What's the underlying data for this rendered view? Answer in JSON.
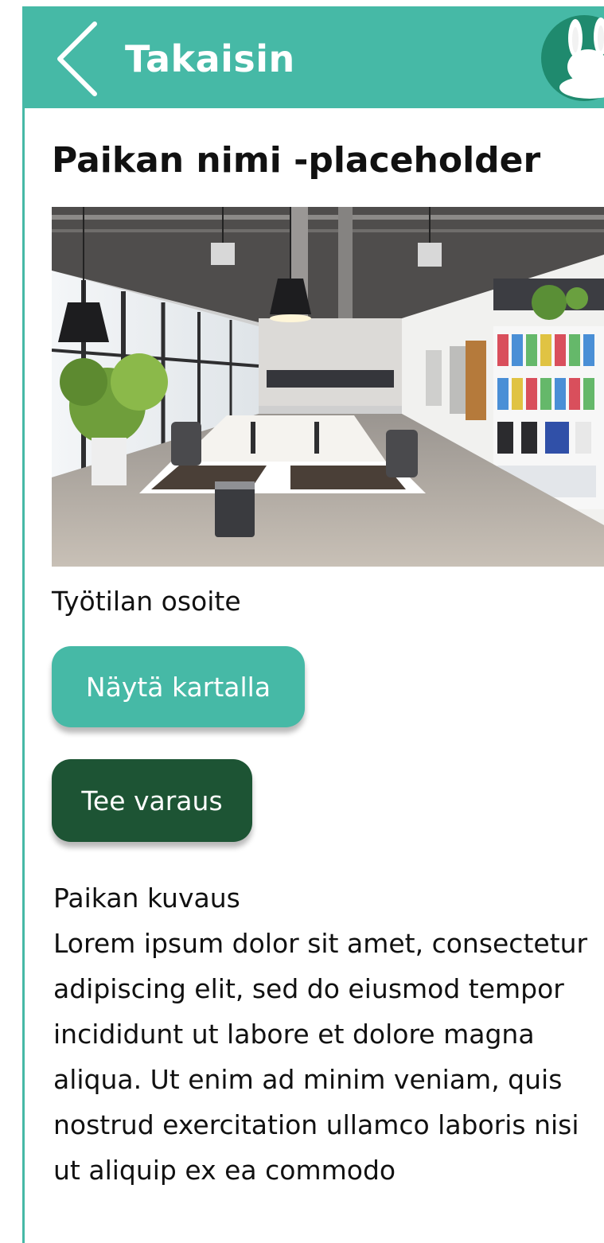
{
  "header": {
    "back_label": "Takaisin",
    "color": "#46b9a6",
    "back_icon": "chevron-left-icon",
    "avatar_icon": "bunny-avatar-icon"
  },
  "place": {
    "title": "Paikan nimi -placeholder",
    "image_icon": "office-photo",
    "address": "Työtilan osoite"
  },
  "actions": {
    "show_on_map": "Näytä kartalla",
    "show_on_map_color": "#46b9a6",
    "make_reservation": "Tee varaus",
    "make_reservation_color": "#1d5434"
  },
  "description": {
    "heading": "Paikan kuvaus",
    "body": "Lorem ipsum dolor sit amet, consectetur adipiscing elit, sed do eiusmod tempor incididunt ut labore et dolore magna aliqua. Ut enim ad minim veniam, quis nostrud exercitation ullamco laboris nisi ut aliquip ex ea commodo"
  }
}
